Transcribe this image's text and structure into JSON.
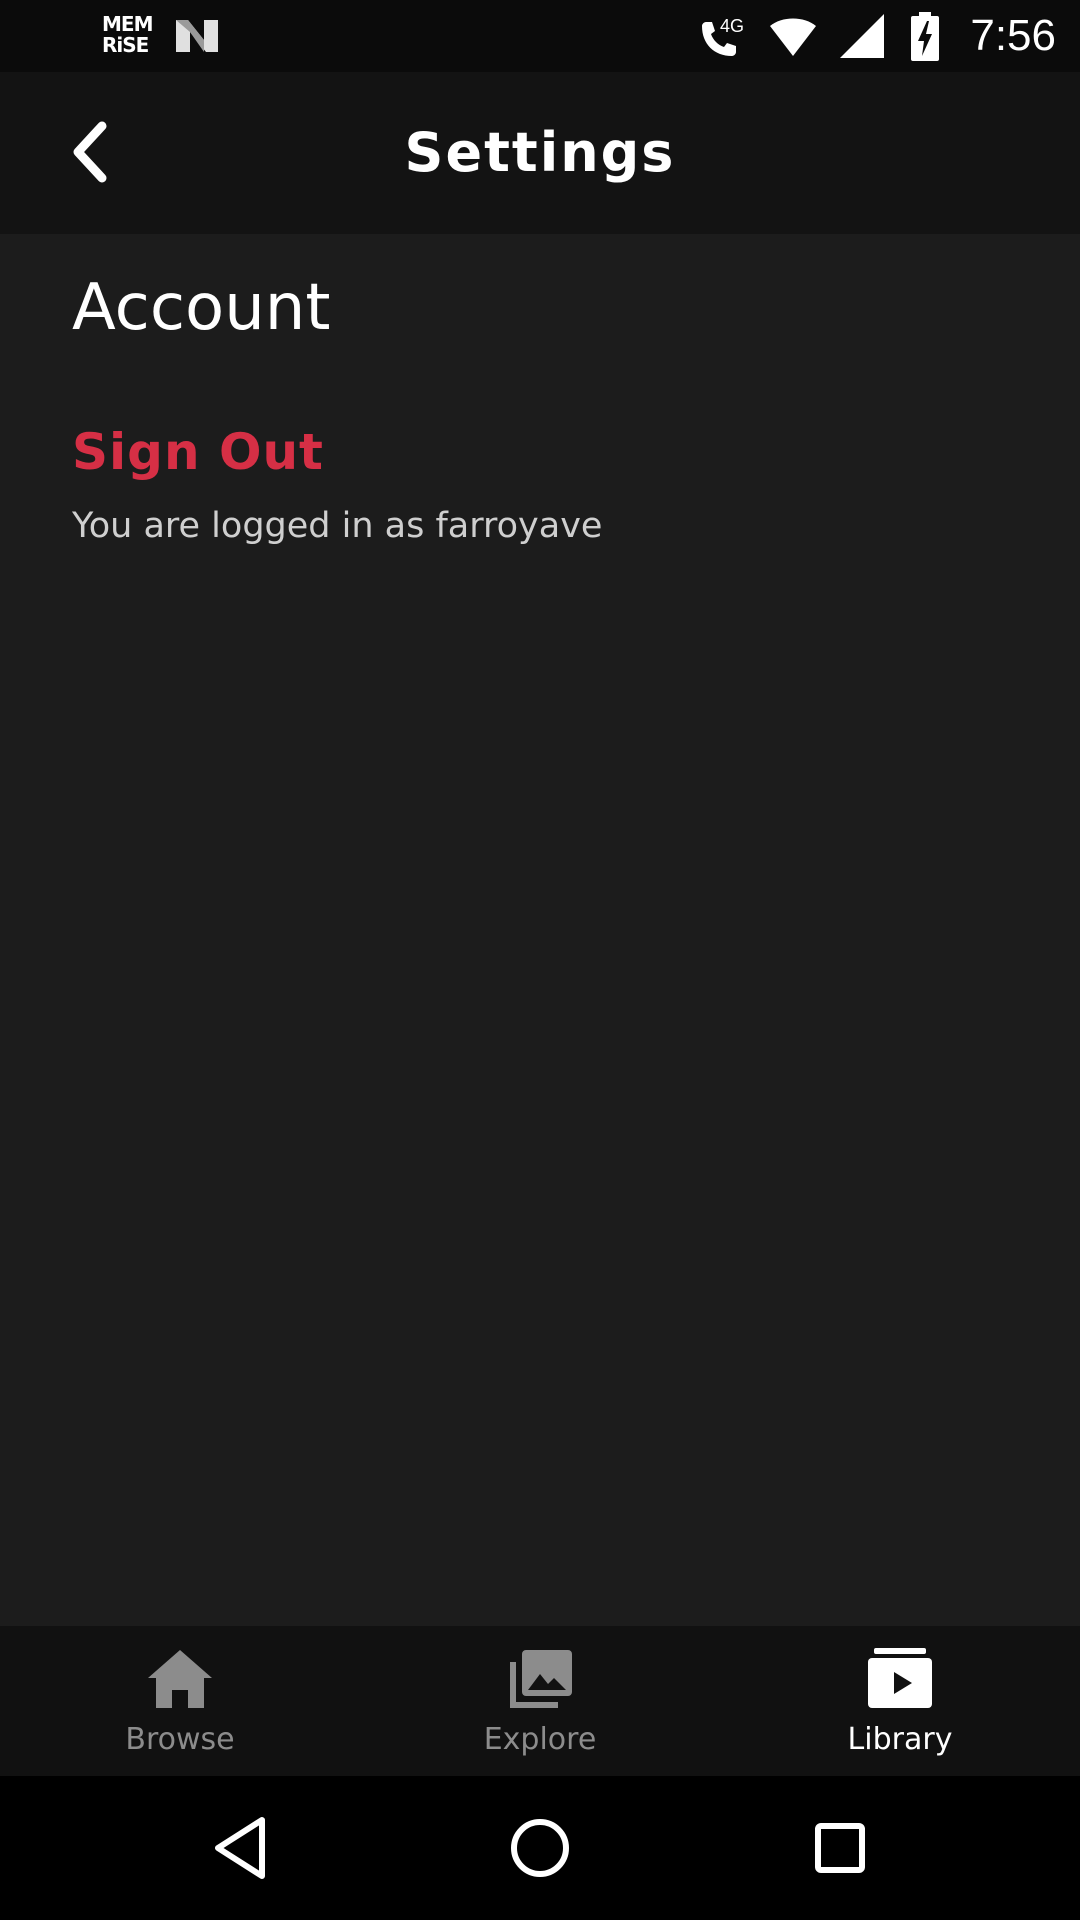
{
  "status_bar": {
    "time": "7:56",
    "logo_text_line1": "MEM",
    "logo_text_line2": "RiSE",
    "network_label": "4G",
    "icons": [
      "memrise-logo-icon",
      "n-notification-icon",
      "wifi-call-icon",
      "wifi-icon",
      "cell-signal-icon",
      "battery-charging-icon"
    ]
  },
  "app_bar": {
    "title": "Settings",
    "back_icon": "chevron-left-icon"
  },
  "account": {
    "section_title": "Account",
    "sign_out_label": "Sign Out",
    "logged_in_text": "You are logged in as farroyave"
  },
  "bottom_nav": {
    "items": [
      {
        "label": "Browse",
        "icon": "home-icon",
        "active": false
      },
      {
        "label": "Explore",
        "icon": "gallery-icon",
        "active": false
      },
      {
        "label": "Library",
        "icon": "video-library-icon",
        "active": true
      }
    ]
  },
  "system_nav": {
    "icons": [
      "back-triangle-icon",
      "home-circle-icon",
      "recents-square-icon"
    ]
  },
  "colors": {
    "background": "#1c1c1c",
    "app_bar": "#131313",
    "accent_red": "#d62f45",
    "inactive_nav": "#8c8c8c"
  }
}
